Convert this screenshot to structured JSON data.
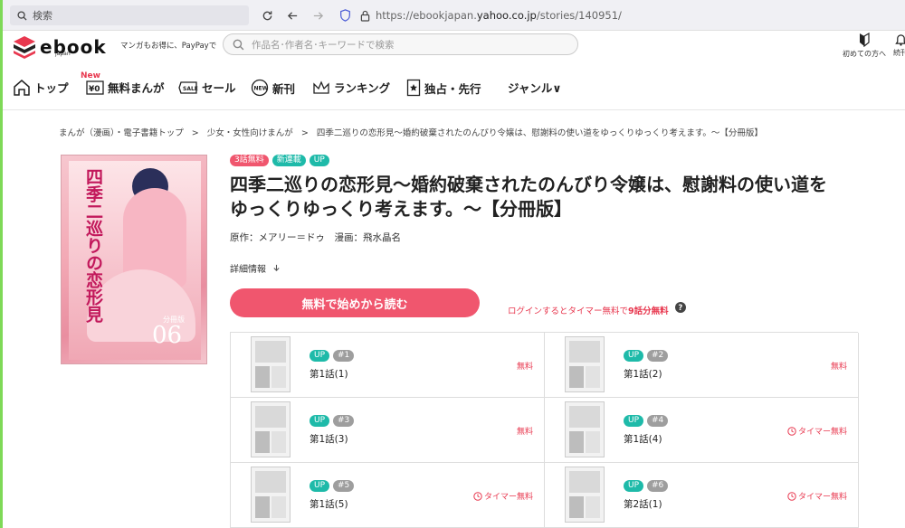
{
  "browser": {
    "search_placeholder": "検索",
    "url_prefix": "https://ebookjapan.",
    "url_domain": "yahoo.co.jp",
    "url_path": "/stories/140951/"
  },
  "header": {
    "logo_text": "ebook",
    "logo_sub": "japan",
    "tagline": "マンガもお得に、PayPayで",
    "search_placeholder": "作品名･作者名･キーワードで検索",
    "beginner_label": "初めての方へ",
    "continue_label": "続刊"
  },
  "nav": {
    "new_tag": "New",
    "items": [
      {
        "label": "トップ"
      },
      {
        "label": "無料まんが"
      },
      {
        "label": "セール"
      },
      {
        "label": "新刊"
      },
      {
        "label": "ランキング"
      },
      {
        "label": "独占・先行"
      },
      {
        "label": "ジャンル∨"
      }
    ]
  },
  "breadcrumb": {
    "items": [
      "まんが（漫画）・電子書籍トップ",
      "少女・女性向けまんが",
      "四季二巡りの恋形見～婚約破棄されたのんびり令嬢は、慰謝料の使い道をゆっくりゆっくり考えます。～【分冊版】"
    ],
    "separator": ">"
  },
  "cover": {
    "title": "四季二巡りの恋形見",
    "volume_label": "分冊版",
    "volume_number": "06"
  },
  "book": {
    "badges": [
      {
        "label": "3話無料",
        "color": "#f0566e"
      },
      {
        "label": "新連載",
        "color": "#1ebaa9"
      },
      {
        "label": "UP",
        "color": "#1ebaa9"
      }
    ],
    "title_line1": "四季二巡りの恋形見～婚約破棄されたのんびり令嬢は、慰謝料の使い道を",
    "title_line2": "ゆっくりゆっくり考えます。～【分冊版】",
    "authors": "原作：メアリー＝ドゥ　漫画：飛水晶名",
    "detail_label": "詳細情報",
    "read_button": "無料で始めから読む",
    "login_note_prefix": "ログインするとタイマー無料で",
    "login_note_bold": "9話分無料",
    "accent_color": "#f0566e"
  },
  "episodes": [
    {
      "up": "UP",
      "num": "#1",
      "label": "第1話(1)",
      "price": "無料",
      "timer": false
    },
    {
      "up": "UP",
      "num": "#2",
      "label": "第1話(2)",
      "price": "無料",
      "timer": false
    },
    {
      "up": "UP",
      "num": "#3",
      "label": "第1話(3)",
      "price": "無料",
      "timer": false
    },
    {
      "up": "UP",
      "num": "#4",
      "label": "第1話(4)",
      "price": "タイマー無料",
      "timer": true
    },
    {
      "up": "UP",
      "num": "#5",
      "label": "第1話(5)",
      "price": "タイマー無料",
      "timer": true
    },
    {
      "up": "UP",
      "num": "#6",
      "label": "第2話(1)",
      "price": "タイマー無料",
      "timer": true
    }
  ]
}
